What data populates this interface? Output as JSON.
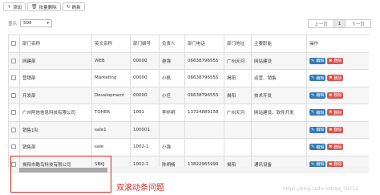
{
  "toolbar": {
    "add_label": "添加",
    "batch_delete_label": "批量删除",
    "refresh_label": "刷新"
  },
  "show": {
    "label": "显示",
    "page_size": "500"
  },
  "pagination": {
    "prev": "上一页",
    "page": "1",
    "next": "下一页"
  },
  "table": {
    "headers": [
      "部门名称",
      "英文名称",
      "部门编号",
      "负责人",
      "部门电话",
      "部门地址",
      "主要职能",
      "操作"
    ],
    "rows": [
      [
        "网建部",
        "WEB",
        "00000",
        "悬强",
        "06638796555",
        "广州天河",
        "网站建设"
      ],
      [
        "营销部",
        "Marketing",
        "00000",
        "小帆",
        "06638796555",
        "揭阳",
        "运营、销售"
      ],
      [
        "开发部",
        "Development",
        "00000",
        "小任",
        "06638796555",
        "揭阳",
        "技术开发"
      ],
      [
        "广州阿信信息科技有限公司",
        "TOHER",
        "1001",
        "李怀明",
        "13724889158",
        "广州天河",
        "网站建设，软件开发"
      ],
      [
        "销售1队",
        "sale1",
        "100001",
        "",
        "",
        "",
        ""
      ],
      [
        "销售部",
        "sale",
        "1002-1",
        "小强",
        "",
        "",
        ""
      ],
      [
        "揭阳市酷鸟科技有限公司",
        "SBKJ",
        "1002-1",
        "陈明畅",
        "13822965999",
        "揭阳",
        "通讯设备"
      ]
    ],
    "edit_label": "编辑",
    "delete_label": "删除"
  },
  "annotation": "双滚动条问题",
  "watermark": "https://blog.csdn.net/qq_39212"
}
